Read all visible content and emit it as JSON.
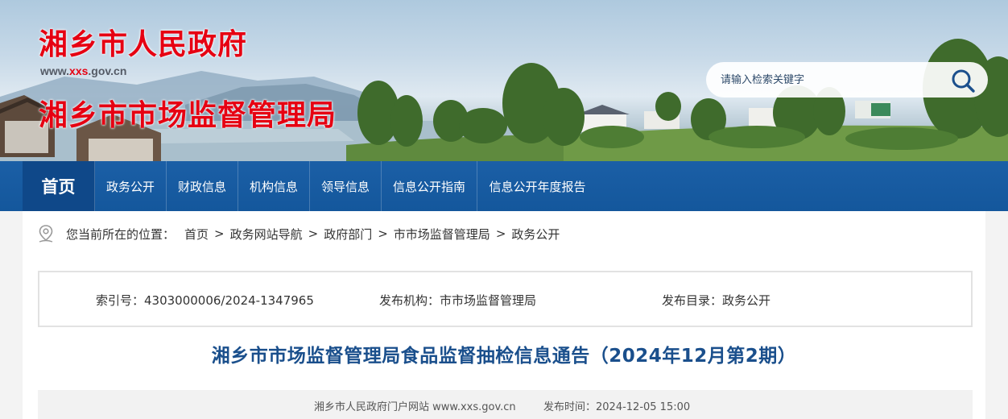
{
  "header": {
    "site_name": "湘乡市人民政府",
    "site_url_prefix": "www.",
    "site_url_highlight": "xxs",
    "site_url_suffix": ".gov.cn",
    "dept_name": "湘乡市市场监督管理局",
    "search_placeholder": "请输入检索关键字",
    "search_icon": "search-icon"
  },
  "nav": {
    "home": "首页",
    "items": [
      "政务公开",
      "财政信息",
      "机构信息",
      "领导信息",
      "信息公开指南",
      "信息公开年度报告"
    ]
  },
  "breadcrumb": {
    "prefix": "您当前所在的位置：",
    "items": [
      "首页",
      "政务网站导航",
      "政府部门",
      "市市场监督管理局",
      "政务公开"
    ],
    "separator": ">"
  },
  "meta": {
    "index_no": "索引号：4303000006/2024-1347965",
    "publisher": "发布机构：市市场监督管理局",
    "catalog": "发布目录：政务公开"
  },
  "article": {
    "title": "湘乡市市场监督管理局食品监督抽检信息通告（2024年12月第2期）",
    "source": "湘乡市人民政府门户网站 www.xxs.gov.cn",
    "publish_time": "发布时间：2024-12-05 15:00"
  },
  "colors": {
    "brand_red": "#e60012",
    "nav_blue": "#1b5fa6",
    "nav_home_blue": "#0f4889",
    "title_blue": "#1a4f8c"
  }
}
